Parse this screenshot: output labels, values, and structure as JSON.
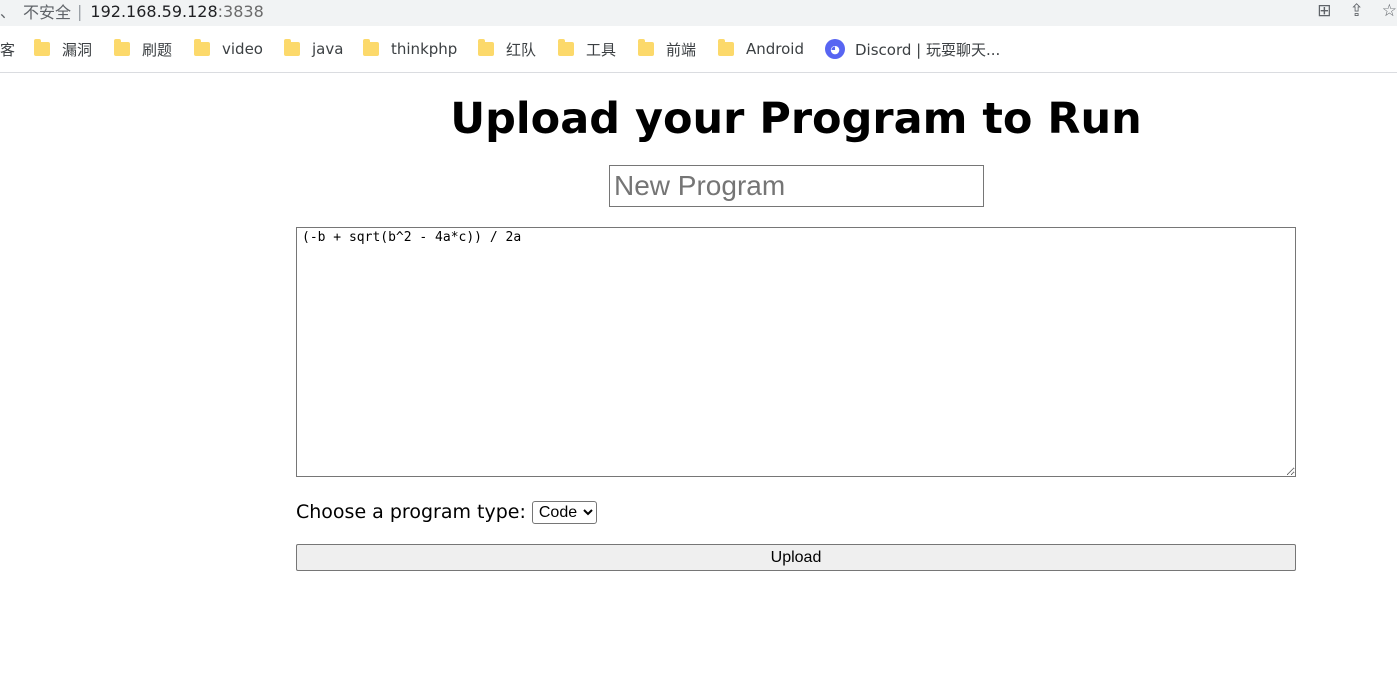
{
  "browser": {
    "left_chars": "、",
    "insecure_label": "不安全",
    "url_host": "192.168.59.128",
    "url_port": ":3838"
  },
  "bookmarks": {
    "partial_first": "客",
    "items": [
      {
        "label": "漏洞"
      },
      {
        "label": "刷题"
      },
      {
        "label": "video"
      },
      {
        "label": "java"
      },
      {
        "label": "thinkphp"
      },
      {
        "label": "红队"
      },
      {
        "label": "工具"
      },
      {
        "label": "前端"
      },
      {
        "label": "Android"
      }
    ],
    "discord": {
      "label": "Discord | 玩耍聊天..."
    }
  },
  "page": {
    "title": "Upload your Program to Run",
    "name_placeholder": "New Program",
    "code_value": "(-b + sqrt(b^2 - 4a*c)) / 2a",
    "type_label": "Choose a program type:",
    "type_selected": "Code",
    "upload_label": "Upload"
  },
  "colors": {
    "folder": "#fcd96b",
    "discord": "#5865f2"
  }
}
